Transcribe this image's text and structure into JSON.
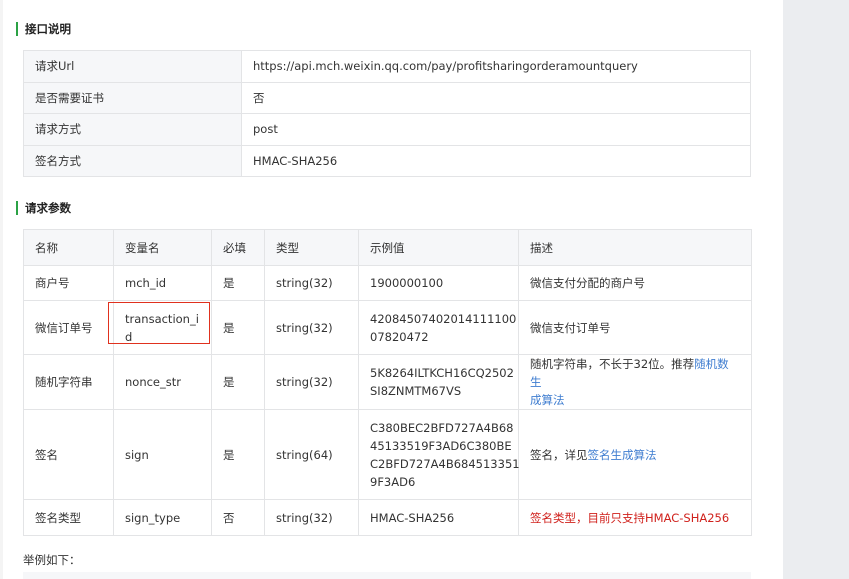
{
  "section1": {
    "title": "接口说明"
  },
  "info_rows": [
    {
      "key": "请求Url",
      "value": "https://api.mch.weixin.qq.com/pay/profitsharingorderamountquery"
    },
    {
      "key": "是否需要证书",
      "value": "否"
    },
    {
      "key": "请求方式",
      "value": "post"
    },
    {
      "key": "签名方式",
      "value": "HMAC-SHA256"
    }
  ],
  "section2": {
    "title": "请求参数"
  },
  "param_headers": [
    "名称",
    "变量名",
    "必填",
    "类型",
    "示例值",
    "描述"
  ],
  "params": [
    {
      "name": "商户号",
      "var": "mch_id",
      "required": "是",
      "type": "string(32)",
      "example": "1900000100",
      "desc": "微信支付分配的商户号"
    },
    {
      "name": "微信订单号",
      "var_line1": "transaction_i",
      "var_line2": "d",
      "required": "是",
      "type": "string(32)",
      "example_line1": "42084507402014111100",
      "example_line2": "07820472",
      "desc": "微信支付订单号"
    },
    {
      "name": "随机字符串",
      "var": "nonce_str",
      "required": "是",
      "type": "string(32)",
      "example_line1": "5K8264ILTKCH16CQ2502",
      "example_line2": "SI8ZNMTM67VS",
      "desc_text": "随机字符串，不长于32位。推荐",
      "desc_link_line1": "随机数生",
      "desc_link_line2": "成算法"
    },
    {
      "name": "签名",
      "var": "sign",
      "required": "是",
      "type": "string(64)",
      "example_line1": "C380BEC2BFD727A4B68",
      "example_line2": "45133519F3AD6C380BE",
      "example_line3": "C2BFD727A4B684513351",
      "example_line4": "9F3AD6",
      "desc_text": "签名，详见",
      "desc_link": "签名生成算法"
    },
    {
      "name": "签名类型",
      "var": "sign_type",
      "required": "否",
      "type": "string(32)",
      "example": "HMAC-SHA256",
      "desc": "签名类型，目前只支持HMAC-SHA256"
    }
  ],
  "example_label": "举例如下：",
  "colors": {
    "accent": "#2ba245",
    "link": "#3f7dd0",
    "warning": "#d0211c",
    "highlight_box": "#e0311e"
  }
}
